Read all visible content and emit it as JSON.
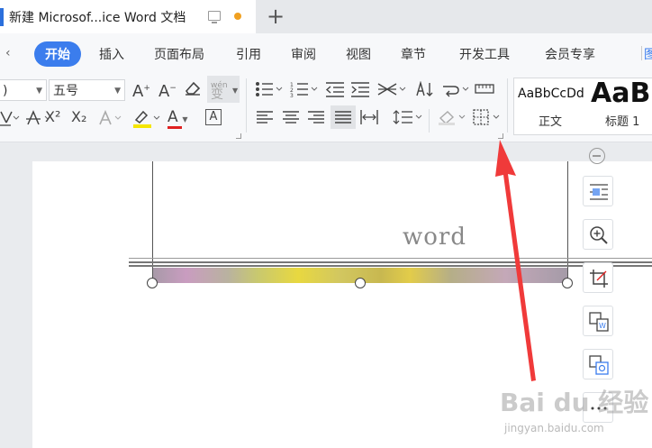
{
  "tab": {
    "title": "新建 Microsof...ice Word 文档",
    "new_tab": "+"
  },
  "menu": {
    "chevron": "‹",
    "items": [
      "开始",
      "插入",
      "页面布局",
      "引用",
      "审阅",
      "视图",
      "章节",
      "开发工具",
      "会员专享"
    ],
    "cut_item": "图"
  },
  "toolbar": {
    "font_name": ")",
    "font_size": "五号",
    "pinyin_top": "wén",
    "pinyin_bottom": "变",
    "superscript": "X²",
    "subscript": "X₂",
    "font_color_letter": "A",
    "grow_letter": "A",
    "shrink_letter": "A",
    "char_border_letter": "A"
  },
  "styles": {
    "normal_preview": "AaBbCcDd",
    "normal_label": "正文",
    "heading_preview": "AaBb",
    "heading_label": "标题 1"
  },
  "document": {
    "text": "word"
  },
  "watermark": {
    "brand": "Bai du 经验",
    "url": "jingyan.baidu.com"
  },
  "colors": {
    "accent": "#3b7ded",
    "arrow": "#f03a3a",
    "highlight": "#f5e600",
    "font_color": "#e02020"
  }
}
